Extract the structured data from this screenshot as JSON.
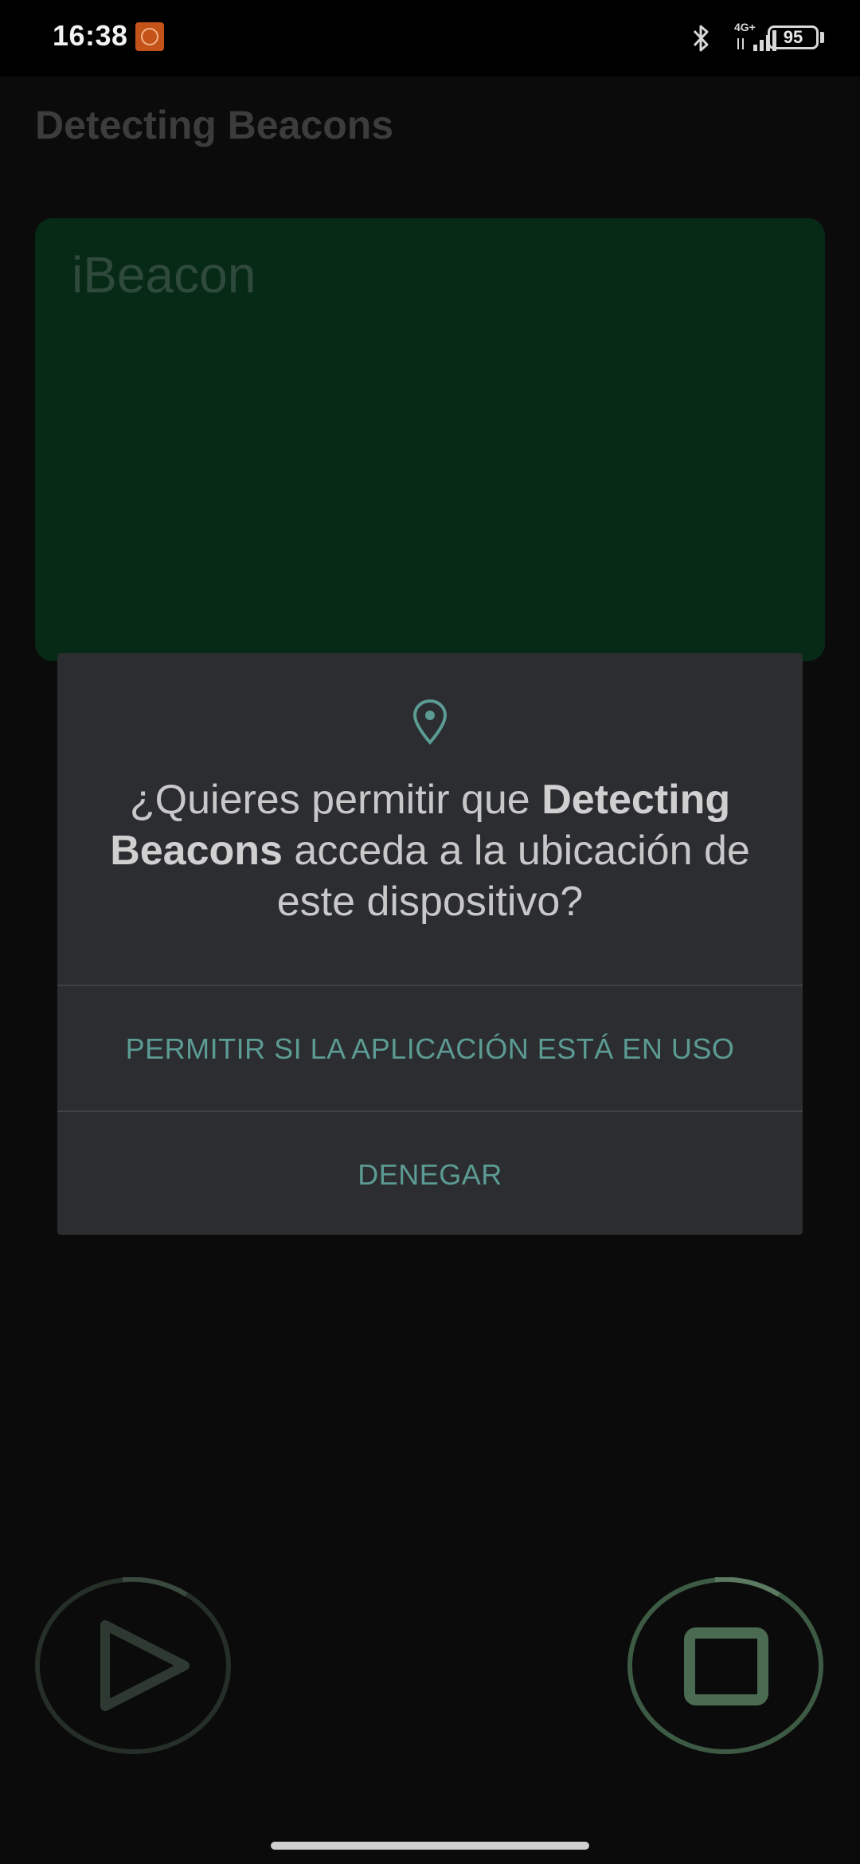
{
  "status_bar": {
    "time": "16:38",
    "network": "4G+",
    "battery": "95"
  },
  "app": {
    "title": "Detecting Beacons",
    "card_title": "iBeacon"
  },
  "dialog": {
    "message_prefix": "¿Quieres permitir que ",
    "message_app": "Detecting Beacons",
    "message_suffix": " acceda a la ubicación de este dispositivo?",
    "allow_label": "PERMITIR SI LA APLICACIÓN ESTÁ EN USO",
    "deny_label": "DENEGAR",
    "icon": "location-pin-icon"
  },
  "controls": {
    "play_icon": "play-icon",
    "stop_icon": "stop-icon"
  },
  "colors": {
    "accent": "#5c9b93",
    "card_background": "#072a17",
    "dialog_background": "#2b2d30"
  }
}
